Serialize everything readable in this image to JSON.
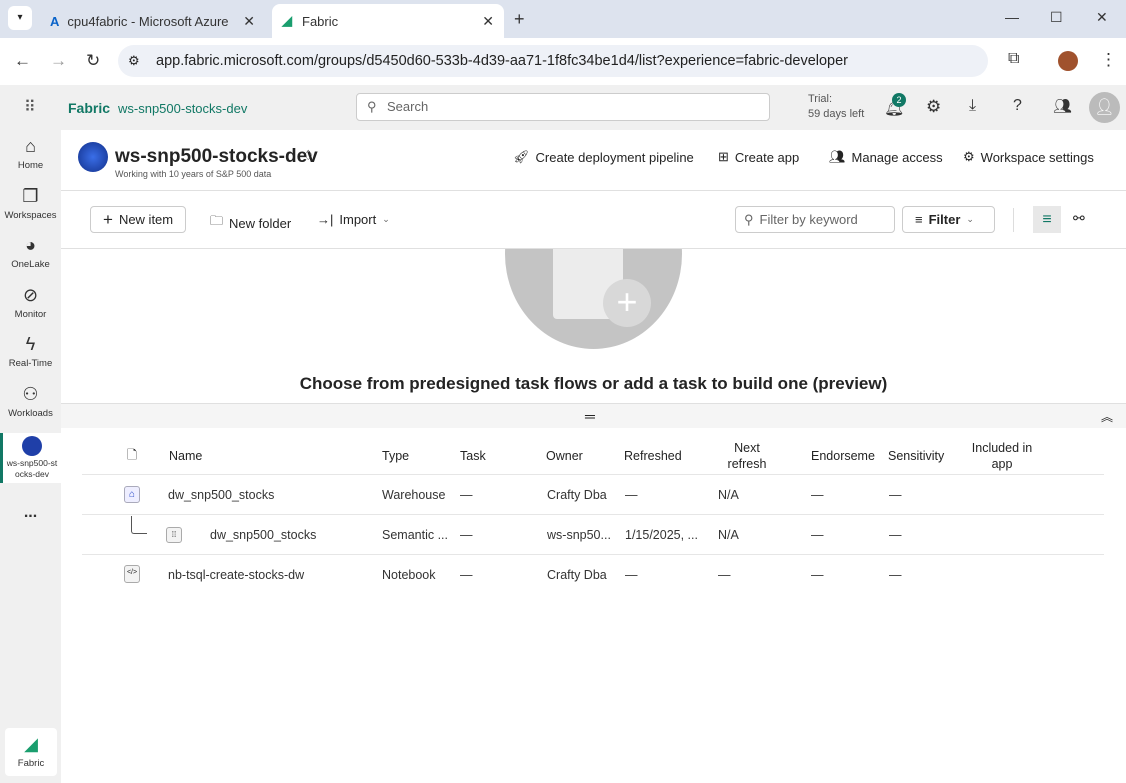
{
  "browser": {
    "tabs": [
      {
        "label": "cpu4fabric - Microsoft Azure",
        "active": false
      },
      {
        "label": "Fabric",
        "active": true
      }
    ],
    "url": "app.fabric.microsoft.com/groups/d5450d60-533b-4d39-aa71-1f8fc34be1d4/list?experience=fabric-developer"
  },
  "header": {
    "brand": "Fabric",
    "workspace": "ws-snp500-stocks-dev",
    "search_placeholder": "Search",
    "trial_line1": "Trial:",
    "trial_line2": "59 days left",
    "notification_count": "2"
  },
  "nav": [
    {
      "label": "Home",
      "icon": "home-icon"
    },
    {
      "label": "Workspaces",
      "icon": "workspaces-icon"
    },
    {
      "label": "OneLake",
      "icon": "onelake-icon"
    },
    {
      "label": "Monitor",
      "icon": "monitor-icon"
    },
    {
      "label": "Real-Time",
      "icon": "lightning-icon"
    },
    {
      "label": "Workloads",
      "icon": "workloads-icon"
    },
    {
      "label": "ws-snp500-stocks-dev",
      "icon": "workspace-avatar"
    }
  ],
  "nav_more": "...",
  "nav_bottom": "Fabric",
  "workspace": {
    "title": "ws-snp500-stocks-dev",
    "subtitle": "Working with 10 years of S&P 500 data",
    "actions": [
      "Create deployment pipeline",
      "Create app",
      "Manage access",
      "Workspace settings"
    ]
  },
  "toolbar": {
    "new_item": "New item",
    "new_folder": "New folder",
    "import": "Import",
    "filter_placeholder": "Filter by keyword",
    "filter": "Filter"
  },
  "taskflow": {
    "message": "Choose from predesigned task flows or add a task to build one (preview)"
  },
  "table": {
    "columns": [
      "Name",
      "Type",
      "Task",
      "Owner",
      "Refreshed",
      "Next refresh",
      "Endorseme",
      "Sensitivity",
      "Included in app"
    ],
    "rows": [
      {
        "name": "dw_snp500_stocks",
        "type": "Warehouse",
        "task": "—",
        "owner": "Crafty Dba",
        "refreshed": "—",
        "next": "N/A",
        "endorsement": "—",
        "sensitivity": "—",
        "icon": "warehouse-icon",
        "child": false
      },
      {
        "name": "dw_snp500_stocks",
        "type": "Semantic ...",
        "task": "—",
        "owner": "ws-snp50...",
        "refreshed": "1/15/2025, ...",
        "next": "N/A",
        "endorsement": "—",
        "sensitivity": "—",
        "icon": "semantic-model-icon",
        "child": true
      },
      {
        "name": "nb-tsql-create-stocks-dw",
        "type": "Notebook",
        "task": "—",
        "owner": "Crafty Dba",
        "refreshed": "—",
        "next": "—",
        "endorsement": "—",
        "sensitivity": "—",
        "icon": "notebook-icon",
        "child": false
      }
    ]
  },
  "colors": {
    "accent": "#117865",
    "badge": "#117865"
  }
}
